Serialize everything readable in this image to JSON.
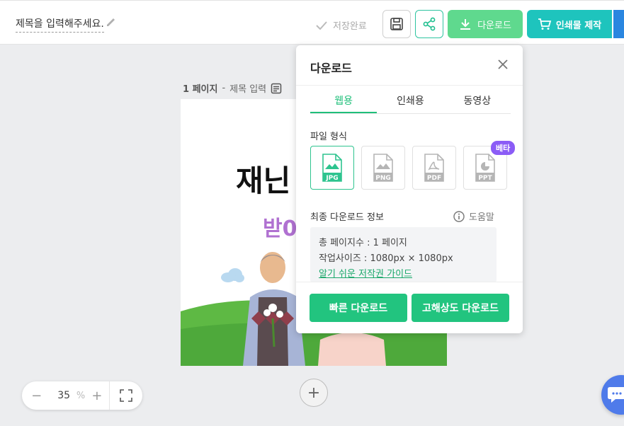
{
  "header": {
    "title_placeholder": "제목을 입력해주세요.",
    "save_status": "저장완료",
    "download_label": "다운로드",
    "print_label": "인쇄물 제작",
    "colors": {
      "download_bg": "#5fd98e",
      "print_bg": "#1ec4bd",
      "accent": "#22c47f"
    }
  },
  "page": {
    "number_label": "1 페이지",
    "separator": " - ",
    "title_placeholder": "제목 입력"
  },
  "canvas": {
    "title_text": "재닌",
    "subtitle_text": "받0"
  },
  "zoom": {
    "value": "35",
    "unit": "%",
    "minus": "−",
    "plus": "+"
  },
  "add_page_symbol": "+",
  "download_panel": {
    "title": "다운로드",
    "tabs": [
      {
        "label": "웹용",
        "active": true
      },
      {
        "label": "인쇄용",
        "active": false
      },
      {
        "label": "동영상",
        "active": false
      }
    ],
    "file_format_label": "파일 형식",
    "formats": [
      {
        "label": "JPG",
        "active": true
      },
      {
        "label": "PNG",
        "active": false
      },
      {
        "label": "PDF",
        "active": false
      },
      {
        "label": "PPT",
        "active": false
      }
    ],
    "beta_badge": "베타",
    "final_info_label": "최종 다운로드 정보",
    "help_label": "도움말",
    "info": {
      "total_pages": "총 페이지수 : 1 페이지",
      "work_size": "작업사이즈 : 1080px × 1080px",
      "copyright_link": "알기 쉬운 저작권 가이드"
    },
    "quick_button": "빠른 다운로드",
    "hq_button": "고해상도 다운로드"
  }
}
